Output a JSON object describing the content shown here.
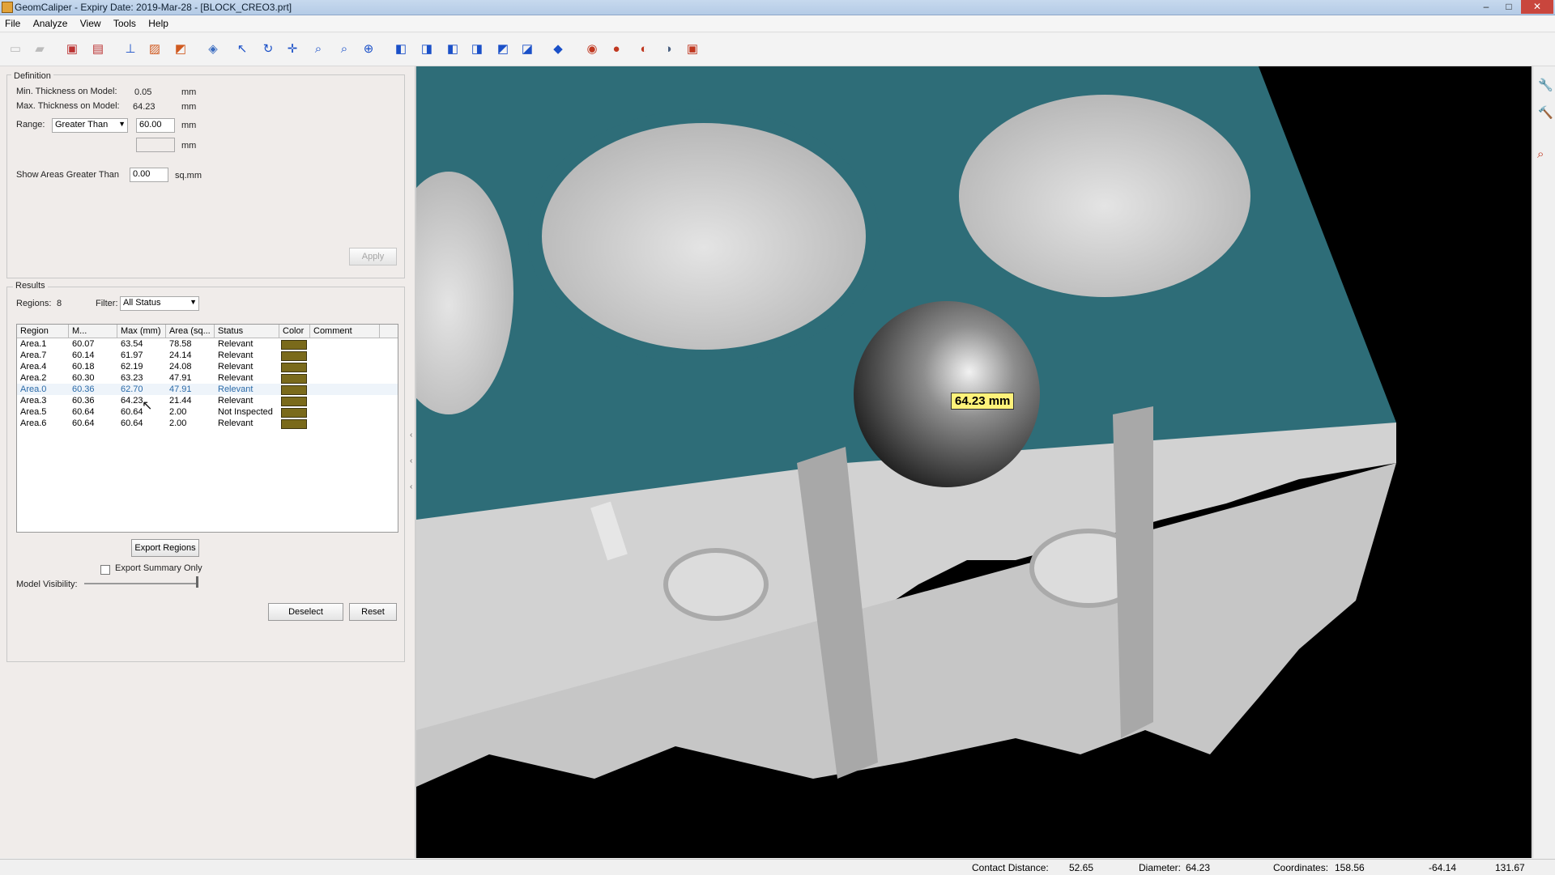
{
  "window": {
    "title": "GeomCaliper - Expiry Date: 2019-Mar-28 - [BLOCK_CREO3.prt]",
    "min": "–",
    "max": "□",
    "close": "✕"
  },
  "menu": [
    "File",
    "Analyze",
    "View",
    "Tools",
    "Help"
  ],
  "toolbar_icons": [
    "new-icon",
    "open-icon",
    "save-icon",
    "save-as-icon",
    "thickness-icon",
    "hatch-icon",
    "sweep-icon",
    "part-icon",
    "select-icon",
    "rotate-icon",
    "pan-icon",
    "zoom-window-icon",
    "zoom-fit-icon",
    "zoom-icon",
    "view-front-icon",
    "view-back-icon",
    "view-left-icon",
    "view-right-icon",
    "view-top-icon",
    "view-bottom-icon",
    "view-iso-icon",
    "shade-icon",
    "sphere-icon",
    "probe-icon",
    "measure-icon",
    "settings-icon"
  ],
  "definition": {
    "group_label": "Definition",
    "min_label": "Min. Thickness on Model:",
    "min_value": "0.05",
    "min_unit": "mm",
    "max_label": "Max. Thickness on Model:",
    "max_value": "64.23",
    "max_unit": "mm",
    "range_label": "Range:",
    "range_select": "Greater Than",
    "range_value": "60.00",
    "range_unit": "mm",
    "range_value2": "",
    "range_unit2": "mm",
    "show_areas_label": "Show Areas Greater Than",
    "show_areas_value": "0.00",
    "show_areas_unit": "sq.mm",
    "apply_label": "Apply"
  },
  "results": {
    "group_label": "Results",
    "regions_label": "Regions:",
    "regions_count": "8",
    "filter_label": "Filter:",
    "filter_value": "All Status",
    "columns": [
      "Region",
      "M...",
      "Max (mm)",
      "Area (sq...",
      "Status",
      "Color",
      "Comment"
    ],
    "rows": [
      {
        "region": "Area.1",
        "min": "60.07",
        "max": "63.54",
        "area": "78.58",
        "status": "Relevant"
      },
      {
        "region": "Area.7",
        "min": "60.14",
        "max": "61.97",
        "area": "24.14",
        "status": "Relevant"
      },
      {
        "region": "Area.4",
        "min": "60.18",
        "max": "62.19",
        "area": "24.08",
        "status": "Relevant"
      },
      {
        "region": "Area.2",
        "min": "60.30",
        "max": "63.23",
        "area": "47.91",
        "status": "Relevant"
      },
      {
        "region": "Area.0",
        "min": "60.36",
        "max": "62.70",
        "area": "47.91",
        "status": "Relevant"
      },
      {
        "region": "Area.3",
        "min": "60.36",
        "max": "64.23",
        "area": "21.44",
        "status": "Relevant"
      },
      {
        "region": "Area.5",
        "min": "60.64",
        "max": "60.64",
        "area": "2.00",
        "status": "Not Inspected"
      },
      {
        "region": "Area.6",
        "min": "60.64",
        "max": "60.64",
        "area": "2.00",
        "status": "Relevant"
      }
    ],
    "swatch_color": "#7a6a1b",
    "export_label": "Export Regions",
    "summary_label": "Export Summary Only",
    "visibility_label": "Model Visibility:",
    "deselect_label": "Deselect",
    "reset_label": "Reset"
  },
  "viewport": {
    "callout": "64.23 mm",
    "teal": "#2e6d78"
  },
  "status": {
    "contact_label": "Contact Distance:",
    "contact_value": "52.65",
    "diameter_label": "Diameter:",
    "diameter_value": "64.23",
    "coord_label": "Coordinates:",
    "x": "158.56",
    "y": "-64.14",
    "z": "131.67"
  }
}
